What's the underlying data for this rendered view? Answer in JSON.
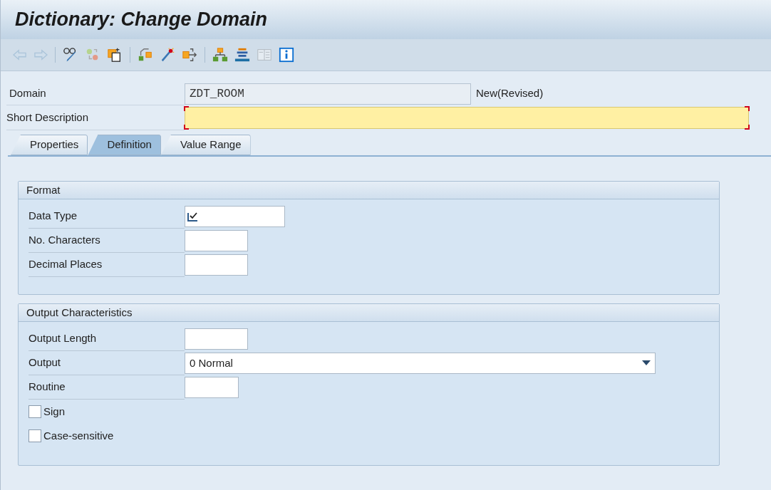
{
  "window": {
    "title": "Dictionary: Change Domain"
  },
  "toolbar": [
    [
      {
        "disabled": true
      },
      {
        "disabled": true
      }
    ],
    [
      {
        "disabled": false
      },
      {
        "disabled": false
      },
      {
        "disabled": false
      }
    ],
    [
      {
        "disabled": false
      },
      {
        "disabled": false
      },
      {
        "disabled": false
      }
    ],
    [
      {
        "disabled": false
      },
      {
        "disabled": false
      },
      {
        "disabled": true
      },
      {
        "disabled": false
      }
    ]
  ],
  "header": {
    "domain": {
      "label": "Domain",
      "value": "ZDT_ROOM",
      "status": "New(Revised)"
    },
    "short_description": {
      "label": "Short Description",
      "required": true
    }
  },
  "tabs": [
    {
      "label": "Properties",
      "selected": false
    },
    {
      "label": "Definition",
      "selected": true
    },
    {
      "label": "Value Range",
      "selected": false
    }
  ],
  "groups": [
    {
      "title": "Format",
      "fields": [
        {
          "kind": "input",
          "label": "Data Type",
          "required": true
        },
        {
          "kind": "input",
          "label": "No. Characters",
          "required": false
        },
        {
          "kind": "input",
          "label": "Decimal Places",
          "required": false
        }
      ]
    },
    {
      "title": "Output Characteristics",
      "fields": [
        {
          "kind": "input",
          "label": "Output Length",
          "required": false
        },
        {
          "kind": "dropdown",
          "label": "Output",
          "value": "0 Normal"
        },
        {
          "kind": "input",
          "label": "Routine",
          "required": false
        },
        {
          "kind": "checkbox",
          "label": "Sign",
          "checked": false
        },
        {
          "kind": "checkbox",
          "label": "Case-sensitive",
          "checked": false
        }
      ]
    }
  ]
}
